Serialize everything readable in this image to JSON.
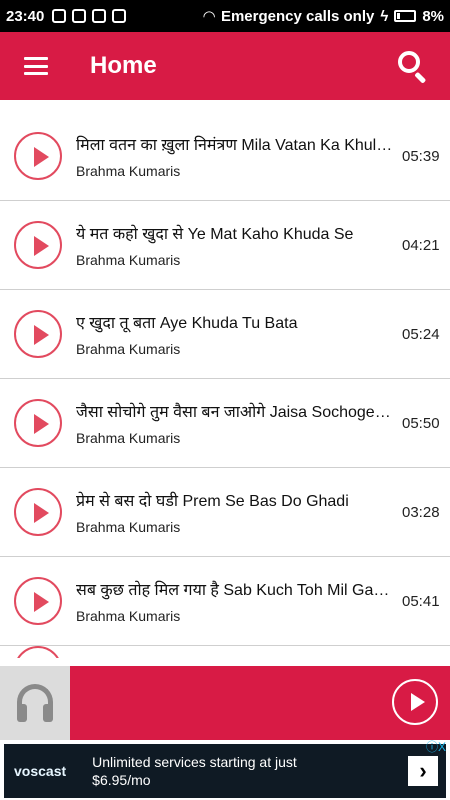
{
  "status_bar": {
    "time": "23:40",
    "carrier": "Emergency calls only",
    "battery": "8%"
  },
  "app_bar": {
    "title": "Home",
    "menu_icon": "hamburger-menu-icon",
    "search_icon": "search-icon"
  },
  "tracks": [
    {
      "title": "मिला वतन का ख़ुला निमंत्रण Mila Vatan Ka Khula Nimantran",
      "artist": "Brahma Kumaris",
      "duration": "05:39"
    },
    {
      "title": "ये मत कहो खुदा से Ye Mat Kaho Khuda Se",
      "artist": "Brahma Kumaris",
      "duration": "04:21"
    },
    {
      "title": "ए खुदा तू बता Aye Khuda Tu Bata",
      "artist": "Brahma Kumaris",
      "duration": "05:24"
    },
    {
      "title": "जैसा सोचोगे तुम वैसा बन जाओगे Jaisa Sochoge Tum",
      "artist": "Brahma Kumaris",
      "duration": "05:50"
    },
    {
      "title": "प्रेम से बस दो घडी Prem Se Bas Do Ghadi",
      "artist": "Brahma Kumaris",
      "duration": "03:28"
    },
    {
      "title": "सब कुछ तोह मिल गया है Sab Kuch Toh Mil Gaya Hai",
      "artist": "Brahma Kumaris",
      "duration": "05:41"
    }
  ],
  "player": {
    "art_icon": "headphones-icon",
    "play_icon": "play-icon"
  },
  "ad": {
    "brand": "voscast",
    "line1": "Unlimited services starting at just",
    "line2": "$6.95/mo",
    "arrow": "›",
    "choice": "ⓘX"
  },
  "colors": {
    "accent": "#d81b45",
    "play_ring": "#e24a5f"
  }
}
